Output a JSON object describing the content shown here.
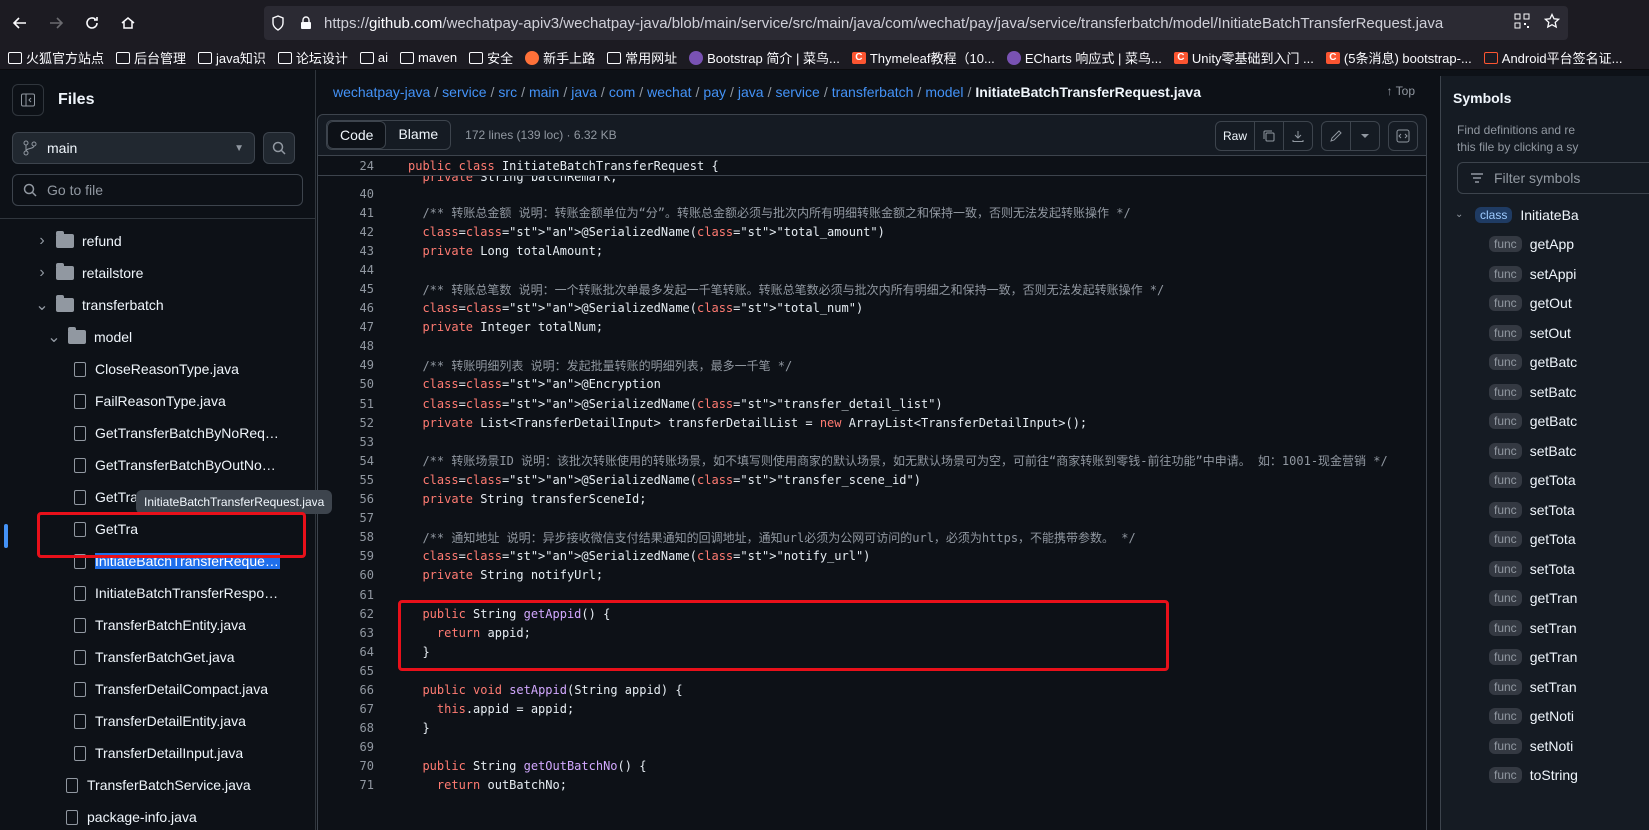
{
  "browser": {
    "url_domain": "github.com",
    "url_prefix": "https://",
    "url_path": "/wechatpay-apiv3/wechatpay-java/blob/main/service/src/main/java/com/wechat/pay/java/service/transferbatch/model/InitiateBatchTransferRequest.java",
    "bookmarks": [
      {
        "label": "火狐官方站点",
        "icon": "folder"
      },
      {
        "label": "后台管理",
        "icon": "folder"
      },
      {
        "label": "java知识",
        "icon": "folder"
      },
      {
        "label": "论坛设计",
        "icon": "folder"
      },
      {
        "label": "ai",
        "icon": "folder"
      },
      {
        "label": "maven",
        "icon": "folder"
      },
      {
        "label": "安全",
        "icon": "folder"
      },
      {
        "label": "新手上路",
        "icon": "firefox"
      },
      {
        "label": "常用网址",
        "icon": "folder"
      },
      {
        "label": "Bootstrap 简介 | 菜鸟...",
        "icon": "runoob"
      },
      {
        "label": "Thymeleaf教程（10...",
        "icon": "csdn"
      },
      {
        "label": "ECharts 响应式 | 菜鸟...",
        "icon": "runoob"
      },
      {
        "label": "Unity零基础到入门 ...",
        "icon": "csdn"
      },
      {
        "label": "(5条消息) bootstrap-...",
        "icon": "csdn"
      },
      {
        "label": "Android平台签名证...",
        "icon": "android"
      }
    ]
  },
  "files_panel": {
    "title": "Files",
    "branch": "main",
    "goto_placeholder": "Go to file",
    "tooltip": "InitiateBatchTransferRequest.java",
    "tree": [
      {
        "label": "refund",
        "type": "folder",
        "depth": 0,
        "expanded": false
      },
      {
        "label": "retailstore",
        "type": "folder",
        "depth": 0,
        "expanded": false
      },
      {
        "label": "transferbatch",
        "type": "folder",
        "depth": 0,
        "expanded": true
      },
      {
        "label": "model",
        "type": "folder",
        "depth": 1,
        "expanded": true
      },
      {
        "label": "CloseReasonType.java",
        "type": "file",
        "depth": 2
      },
      {
        "label": "FailReasonType.java",
        "type": "file",
        "depth": 2
      },
      {
        "label": "GetTransferBatchByNoReques...",
        "type": "file",
        "depth": 2
      },
      {
        "label": "GetTransferBatchByOutNoRe...",
        "type": "file",
        "depth": 2
      },
      {
        "label": "GetTransferDetailByNoReques...",
        "type": "file",
        "depth": 2
      },
      {
        "label": "GetTra",
        "type": "file",
        "depth": 2
      },
      {
        "label": "InitiateBatchTransferRequest.j...",
        "type": "file",
        "depth": 2,
        "active": true
      },
      {
        "label": "InitiateBatchTransferResponse...",
        "type": "file",
        "depth": 2
      },
      {
        "label": "TransferBatchEntity.java",
        "type": "file",
        "depth": 2
      },
      {
        "label": "TransferBatchGet.java",
        "type": "file",
        "depth": 2
      },
      {
        "label": "TransferDetailCompact.java",
        "type": "file",
        "depth": 2
      },
      {
        "label": "TransferDetailEntity.java",
        "type": "file",
        "depth": 2
      },
      {
        "label": "TransferDetailInput.java",
        "type": "file",
        "depth": 2
      },
      {
        "label": "TransferBatchService.java",
        "type": "file",
        "depth": 1
      },
      {
        "label": "package-info.java",
        "type": "file",
        "depth": 1
      }
    ]
  },
  "breadcrumb": {
    "parts": [
      "wechatpay-java",
      "service",
      "src",
      "main",
      "java",
      "com",
      "wechat",
      "pay",
      "java",
      "service",
      "transferbatch",
      "model"
    ],
    "current": "InitiateBatchTransferRequest.java",
    "top_label": "Top"
  },
  "toolbar": {
    "code_tab": "Code",
    "blame_tab": "Blame",
    "meta": "172 lines (139 loc) · 6.32 KB",
    "raw_label": "Raw"
  },
  "code": {
    "sticky": {
      "num": "24",
      "text": "public class InitiateBatchTransferRequest {"
    },
    "clipped": "  private String batchRemark;",
    "lines": [
      {
        "num": "40",
        "text": ""
      },
      {
        "num": "41",
        "text": "  /** 转账总金额 说明：转账金额单位为“分”。转账总金额必须与批次内所有明细转账金额之和保持一致，否则无法发起转账操作 */"
      },
      {
        "num": "42",
        "text": "  @SerializedName(\"total_amount\")"
      },
      {
        "num": "43",
        "text": "  private Long totalAmount;"
      },
      {
        "num": "44",
        "text": ""
      },
      {
        "num": "45",
        "text": "  /** 转账总笔数 说明：一个转账批次单最多发起一千笔转账。转账总笔数必须与批次内所有明细之和保持一致，否则无法发起转账操作 */"
      },
      {
        "num": "46",
        "text": "  @SerializedName(\"total_num\")"
      },
      {
        "num": "47",
        "text": "  private Integer totalNum;"
      },
      {
        "num": "48",
        "text": ""
      },
      {
        "num": "49",
        "text": "  /** 转账明细列表 说明：发起批量转账的明细列表，最多一千笔 */"
      },
      {
        "num": "50",
        "text": "  @Encryption"
      },
      {
        "num": "51",
        "text": "  @SerializedName(\"transfer_detail_list\")"
      },
      {
        "num": "52",
        "text": "  private List<TransferDetailInput> transferDetailList = new ArrayList<TransferDetailInput>();"
      },
      {
        "num": "53",
        "text": ""
      },
      {
        "num": "54",
        "text": "  /** 转账场景ID 说明：该批次转账使用的转账场景，如不填写则使用商家的默认场景，如无默认场景可为空，可前往“商家转账到零钱-前往功能”中申请。 如：1001-现金营销 */"
      },
      {
        "num": "55",
        "text": "  @SerializedName(\"transfer_scene_id\")"
      },
      {
        "num": "56",
        "text": "  private String transferSceneId;"
      },
      {
        "num": "57",
        "text": ""
      },
      {
        "num": "58",
        "text": "  /** 通知地址 说明：异步接收微信支付结果通知的回调地址，通知url必须为公网可访问的url，必须为https，不能携带参数。 */"
      },
      {
        "num": "59",
        "text": "  @SerializedName(\"notify_url\")"
      },
      {
        "num": "60",
        "text": "  private String notifyUrl;"
      },
      {
        "num": "61",
        "text": ""
      },
      {
        "num": "62",
        "text": "  public String getAppid() {"
      },
      {
        "num": "63",
        "text": "    return appid;"
      },
      {
        "num": "64",
        "text": "  }"
      },
      {
        "num": "65",
        "text": ""
      },
      {
        "num": "66",
        "text": "  public void setAppid(String appid) {"
      },
      {
        "num": "67",
        "text": "    this.appid = appid;"
      },
      {
        "num": "68",
        "text": "  }"
      },
      {
        "num": "69",
        "text": ""
      },
      {
        "num": "70",
        "text": "  public String getOutBatchNo() {"
      },
      {
        "num": "71",
        "text": "    return outBatchNo;"
      }
    ]
  },
  "symbols": {
    "title": "Symbols",
    "desc1": "Find definitions and re",
    "desc2": "this file by clicking a sy",
    "filter_placeholder": "Filter symbols",
    "class_badge": "class",
    "func_badge": "func",
    "class_name": "InitiateBa",
    "funcs": [
      "getApp",
      "setAppi",
      "getOut",
      "setOut",
      "getBatc",
      "setBatc",
      "getBatc",
      "setBatc",
      "getTota",
      "setTota",
      "getTota",
      "setTota",
      "getTran",
      "setTran",
      "getTran",
      "setTran",
      "getNoti",
      "setNoti",
      "toString"
    ]
  }
}
